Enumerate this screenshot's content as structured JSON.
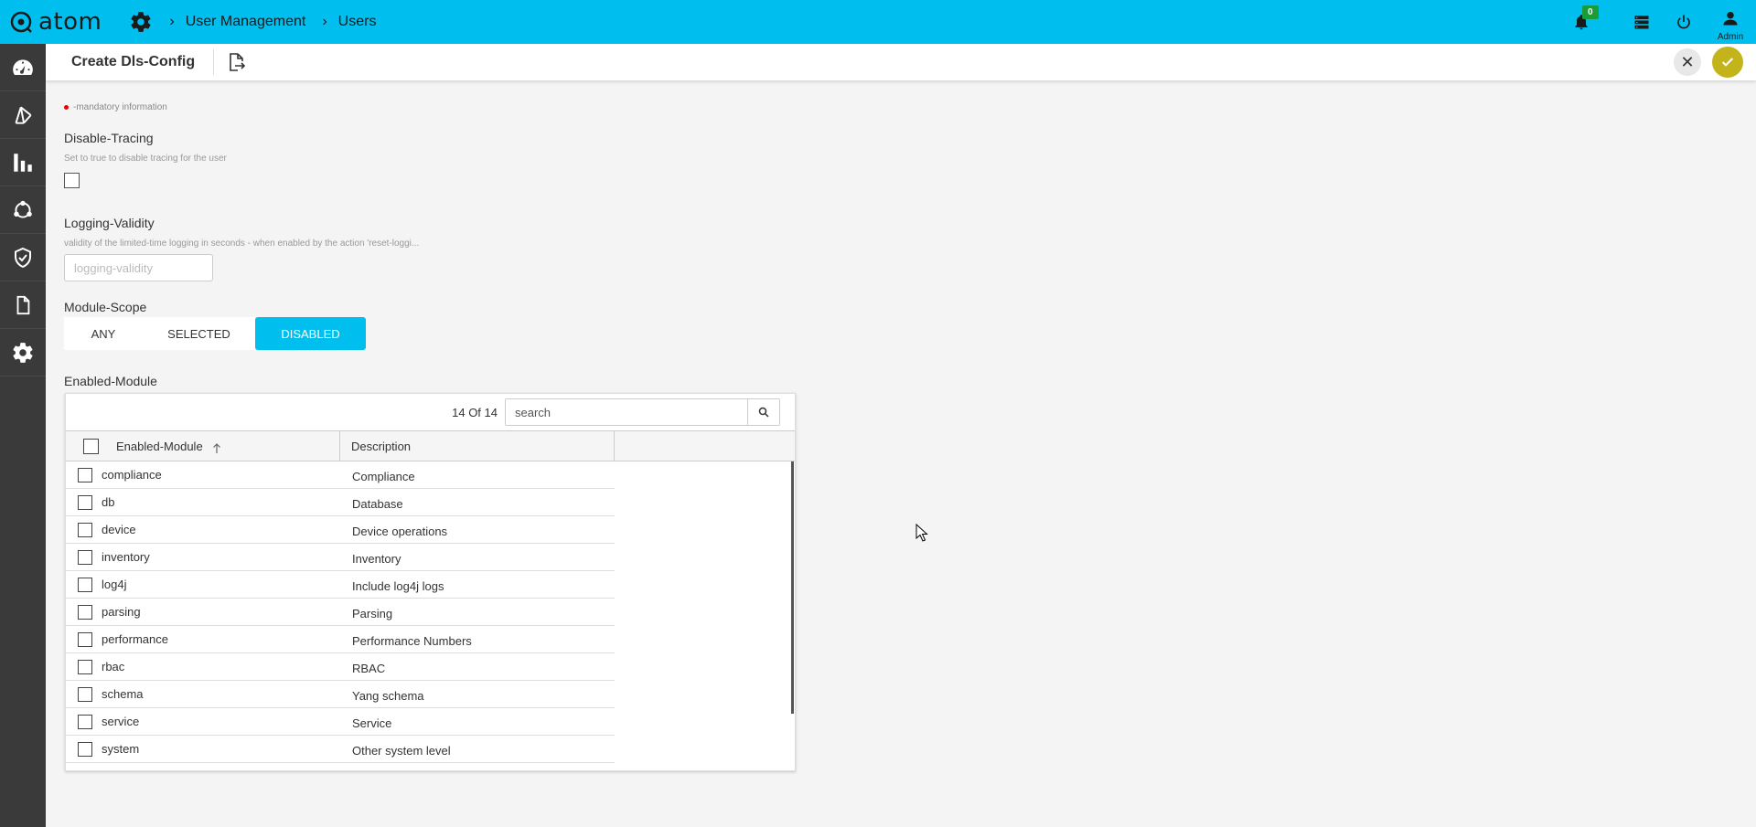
{
  "app": {
    "logo_text": "atom"
  },
  "breadcrumb": {
    "items": [
      "User Management",
      "Users"
    ]
  },
  "topbar": {
    "notification_count": "0",
    "user_label": "Admin"
  },
  "page": {
    "title": "Create Dls-Config"
  },
  "form": {
    "mandatory_note": "-mandatory information",
    "disable_tracing": {
      "label": "Disable-Tracing",
      "help": "Set to true to disable tracing for the user",
      "checked": false
    },
    "logging_validity": {
      "label": "Logging-Validity",
      "help": "validity of the limited-time logging in seconds - when enabled by the action 'reset-loggi...",
      "placeholder": "logging-validity",
      "value": ""
    },
    "module_scope": {
      "label": "Module-Scope",
      "options": [
        "ANY",
        "SELECTED",
        "DISABLED"
      ],
      "selected": "DISABLED"
    },
    "enabled_module": {
      "label": "Enabled-Module",
      "count_text": "14 Of 14",
      "search_placeholder": "search",
      "columns": [
        "Enabled-Module",
        "Description"
      ],
      "rows": [
        {
          "name": "compliance",
          "desc": "Compliance"
        },
        {
          "name": "db",
          "desc": "Database"
        },
        {
          "name": "device",
          "desc": "Device operations"
        },
        {
          "name": "inventory",
          "desc": "Inventory"
        },
        {
          "name": "log4j",
          "desc": "Include log4j logs"
        },
        {
          "name": "parsing",
          "desc": "Parsing"
        },
        {
          "name": "performance",
          "desc": "Performance Numbers"
        },
        {
          "name": "rbac",
          "desc": "RBAC"
        },
        {
          "name": "schema",
          "desc": "Yang schema"
        },
        {
          "name": "service",
          "desc": "Service"
        },
        {
          "name": "system",
          "desc": "Other system level"
        }
      ]
    }
  },
  "colors": {
    "accent": "#00bfef",
    "sidebar": "#3a3a3a",
    "save": "#c4b41c",
    "badge": "#1a9c3a"
  }
}
